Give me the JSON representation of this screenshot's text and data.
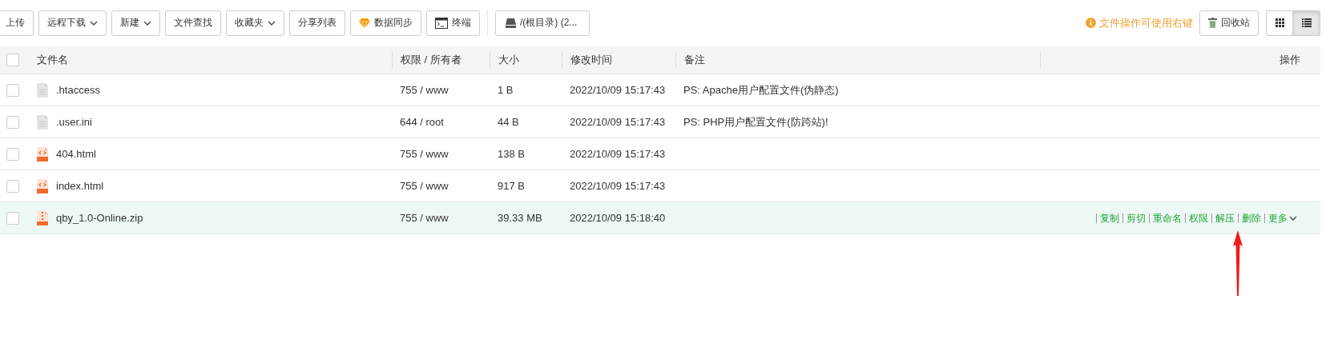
{
  "toolbar": {
    "buttons": [
      {
        "label": "上传",
        "kind": "plain"
      },
      {
        "label": "远程下载",
        "kind": "dropdown"
      },
      {
        "label": "新建",
        "kind": "dropdown"
      },
      {
        "label": "文件查找",
        "kind": "plain"
      },
      {
        "label": "收藏夹",
        "kind": "dropdown"
      },
      {
        "label": "分享列表",
        "kind": "plain"
      },
      {
        "label": "数据同步",
        "kind": "gem"
      },
      {
        "label": "终端",
        "kind": "terminal"
      }
    ],
    "path": "/(根目录) (2...",
    "hint": "文件操作可使用右键",
    "recycle": "回收站",
    "views": [
      {
        "kind": "grid",
        "selected": false
      },
      {
        "kind": "list",
        "selected": true
      }
    ]
  },
  "table": {
    "columns": [
      "文件名",
      "权限 / 所有者",
      "大小",
      "修改时间",
      "备注",
      "操作"
    ],
    "select_all": {
      "checked": false
    },
    "rows": [
      {
        "kind": "text",
        "name": ".htaccess",
        "perm": "755 / www",
        "size": "1 B",
        "time": "2022/10/09 15:17:43",
        "note": "PS: Apache用户配置文件(伪静态)",
        "checked": false,
        "highlighted": false
      },
      {
        "kind": "text",
        "name": ".user.ini",
        "perm": "644 / root",
        "size": "44 B",
        "time": "2022/10/09 15:17:43",
        "note": "PS: PHP用户配置文件(防跨站)!",
        "checked": false,
        "highlighted": false
      },
      {
        "kind": "html",
        "name": "404.html",
        "perm": "755 / www",
        "size": "138 B",
        "time": "2022/10/09 15:17:43",
        "checked": false,
        "highlighted": false
      },
      {
        "kind": "html",
        "name": "index.html",
        "perm": "755 / www",
        "size": "917 B",
        "time": "2022/10/09 15:17:43",
        "checked": false,
        "highlighted": false
      },
      {
        "kind": "zip",
        "name": "qby_1.0-Online.zip",
        "perm": "755 / www",
        "size": "39.33 MB",
        "time": "2022/10/09 15:18:40",
        "checked": false,
        "highlighted": true,
        "actions": [
          {
            "label": "复制",
            "kind": "link"
          },
          {
            "label": "剪切",
            "kind": "link"
          },
          {
            "label": "重命名",
            "kind": "link"
          },
          {
            "label": "权限",
            "kind": "link"
          },
          {
            "label": "解压",
            "kind": "link"
          },
          {
            "label": "删除",
            "kind": "link"
          },
          {
            "label": "更多",
            "kind": "dropdown"
          }
        ]
      }
    ]
  },
  "annotation": {
    "kind": "arrow"
  }
}
